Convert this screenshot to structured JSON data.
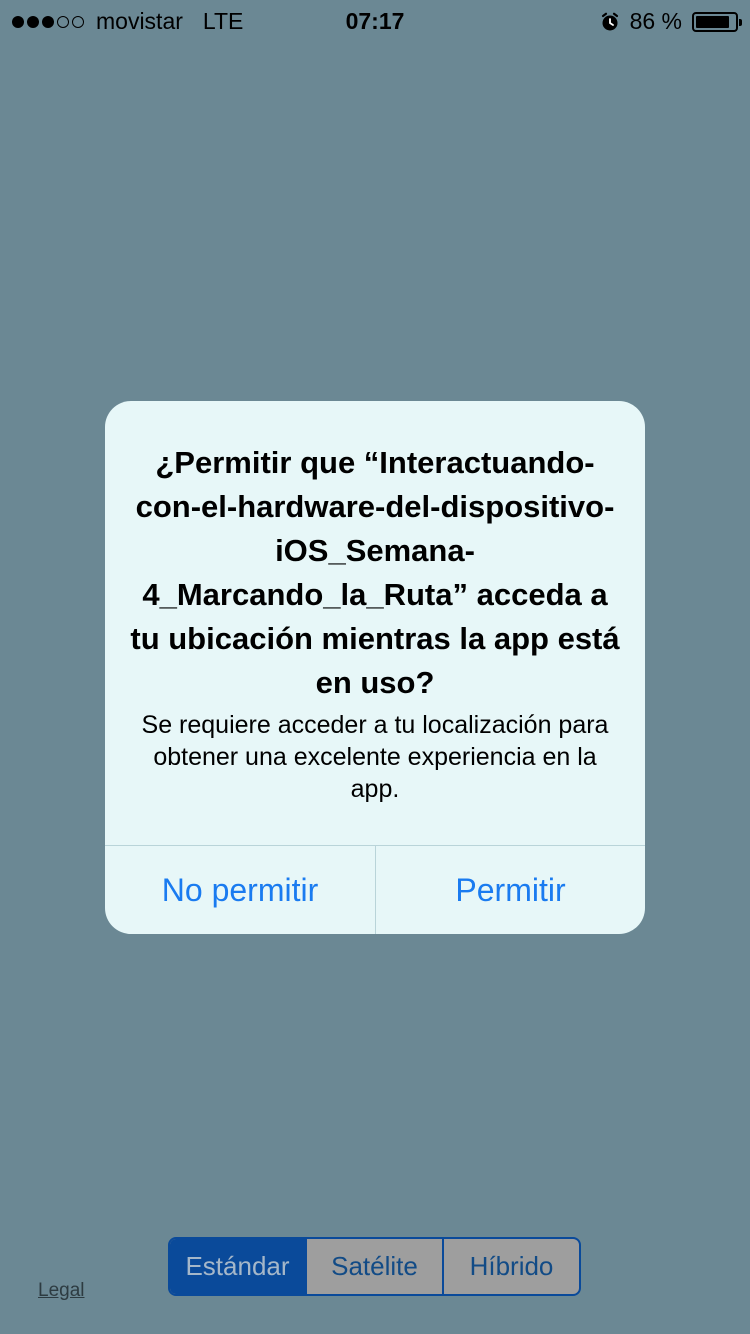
{
  "status_bar": {
    "signal_dots_filled": 3,
    "signal_dots_total": 5,
    "carrier": "movistar",
    "network": "LTE",
    "time": "07:17",
    "alarm_icon": "alarm-clock-icon",
    "battery_percent_label": "86 %",
    "battery_level": 0.86
  },
  "alert": {
    "title": "¿Permitir que “Interactuando-con-el-hardware-del-dispositivo-iOS_Semana-4_Marcando_la_Ruta” acceda a tu ubicación mientras la app está en uso?",
    "message": "Se requiere acceder a tu localización para obtener una excelente experiencia en la app.",
    "deny_label": "No permitir",
    "allow_label": "Permitir"
  },
  "map_controls": {
    "segments": [
      "Estándar",
      "Satélite",
      "Híbrido"
    ],
    "selected_index": 0,
    "legal_label": "Legal"
  },
  "colors": {
    "background": "#6b8894",
    "alert_background": "#e7f7f8",
    "button_blue": "#1a7bf0",
    "segment_accent": "#0a4a9a"
  }
}
